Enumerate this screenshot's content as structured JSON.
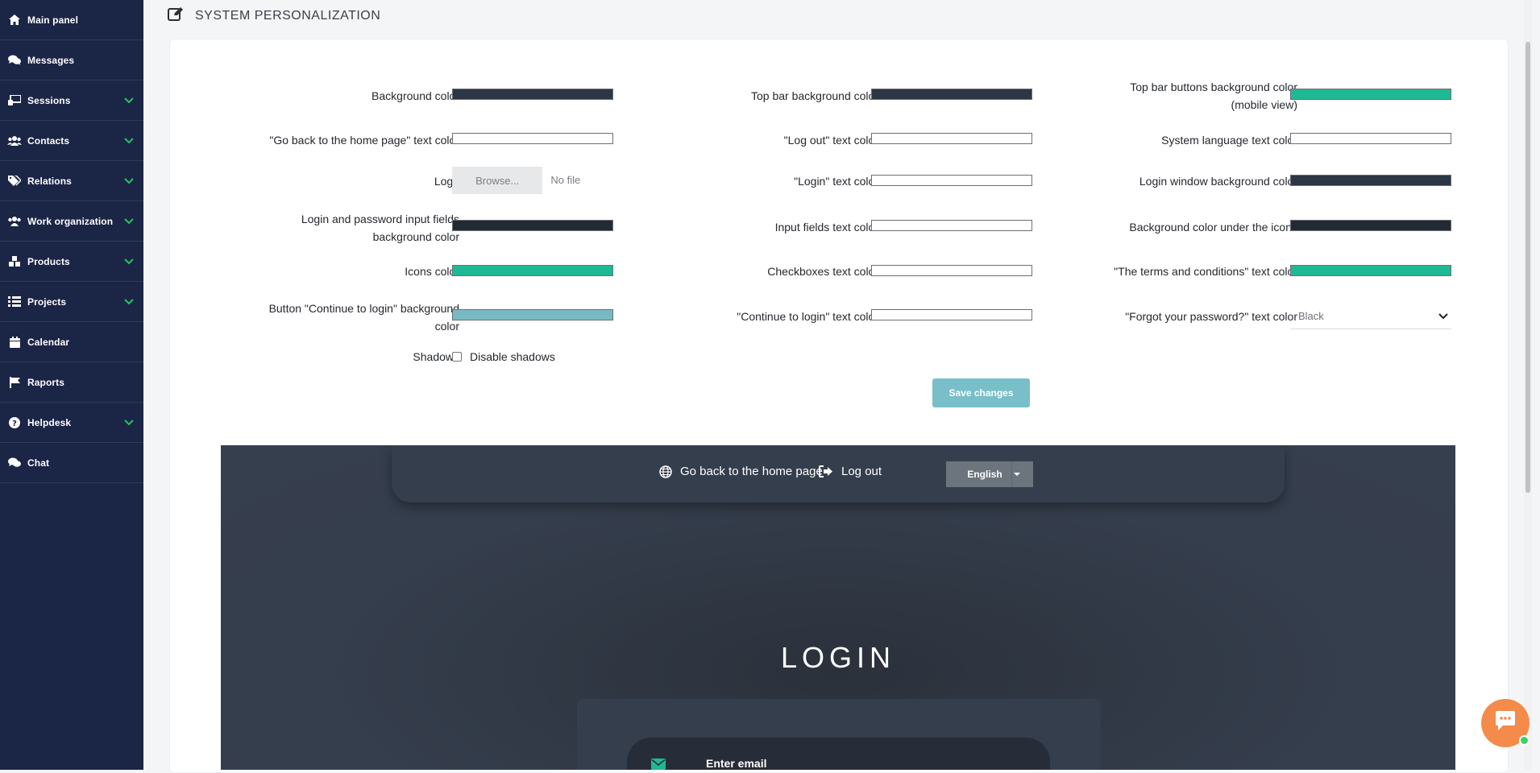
{
  "sidebar": {
    "items": [
      {
        "label": "Main panel",
        "icon": "home-icon",
        "expandable": false
      },
      {
        "label": "Messages",
        "icon": "chat-bubbles-icon",
        "expandable": false
      },
      {
        "label": "Sessions",
        "icon": "sessions-icon",
        "expandable": true
      },
      {
        "label": "Contacts",
        "icon": "users-icon",
        "expandable": true
      },
      {
        "label": "Relations",
        "icon": "tags-icon",
        "expandable": true
      },
      {
        "label": "Work organization",
        "icon": "team-icon",
        "expandable": true
      },
      {
        "label": "Products",
        "icon": "cubes-icon",
        "expandable": true
      },
      {
        "label": "Projects",
        "icon": "tasks-icon",
        "expandable": true
      },
      {
        "label": "Calendar",
        "icon": "calendar-icon",
        "expandable": false
      },
      {
        "label": "Raports",
        "icon": "flag-icon",
        "expandable": false
      },
      {
        "label": "Helpdesk",
        "icon": "question-icon",
        "expandable": true
      },
      {
        "label": "Chat",
        "icon": "chat-bubbles-icon",
        "expandable": false
      }
    ],
    "chevron_color": "#23c65a"
  },
  "header": {
    "title": "SYSTEM PERSONALIZATION",
    "icon": "edit-icon"
  },
  "form": {
    "fields": [
      {
        "label": "Background color",
        "color": "#2d3644"
      },
      {
        "label": "Top bar background color",
        "color": "#2d3644"
      },
      {
        "label": "Top bar buttons background color (mobile view)",
        "color": "#1fb895"
      },
      {
        "label": "\"Go back to the home page\" text color",
        "color": "#ffffff"
      },
      {
        "label": "\"Log out\" text color",
        "color": "#ffffff"
      },
      {
        "label": "System language text color",
        "color": "#ffffff"
      },
      {
        "label": "Logo",
        "file_button": "Browse...",
        "file_text": "No file selected."
      },
      {
        "label": "\"Login\" text color",
        "color": "#ffffff"
      },
      {
        "label": "Login window background color",
        "color": "#2d3644"
      },
      {
        "label": "Login and password input fields background color",
        "color": "#232a34"
      },
      {
        "label": "Input fields text color",
        "color": "#ffffff"
      },
      {
        "label": "Background color under the icons",
        "color": "#232a34"
      },
      {
        "label": "Icons color",
        "color": "#1fb895"
      },
      {
        "label": "Checkboxes text color",
        "color": "#ffffff"
      },
      {
        "label": "\"The terms and conditions\" text color",
        "color": "#1fb895"
      },
      {
        "label": "Button \"Continue to login\" background color",
        "color": "#77bac4"
      },
      {
        "label": "\"Continue to login\" text color",
        "color": "#ffffff"
      },
      {
        "label": "\"Forgot your password?\" text color",
        "select_value": "Black"
      }
    ],
    "shadows": {
      "label": "Shadows",
      "checkbox_label": "Disable shadows",
      "checked": false
    },
    "save_label": "Save changes"
  },
  "preview": {
    "home_link": "Go back to the home page",
    "logout_link": "Log out",
    "language": "English",
    "login_title": "LOGIN",
    "email_placeholder": "Enter email",
    "background": "#363f4e",
    "accent": "#1fb895"
  }
}
